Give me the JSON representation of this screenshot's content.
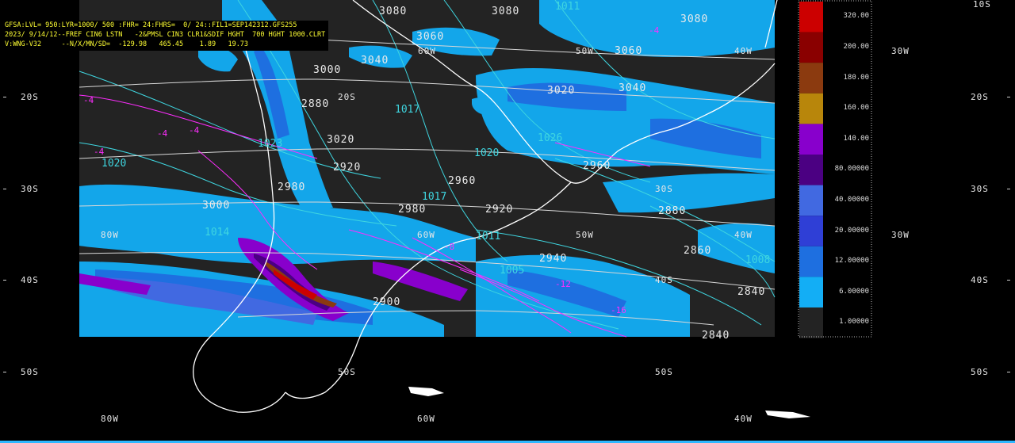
{
  "header": {
    "line1": "GFSA:LVL= 950:LYR=1000/ 500 :FHR= 24:FHRS=  0/ 24::FIL1=SEP142312.GFS255",
    "line2": "2023/ 9/14/12--FREF CIN6 LSTN   -2&PMSL CIN3 CLR1&SDIF HGHT  700 HGHT 1000.CLRT",
    "line3": "V:WNG-V32     --N/X/MN/SD=  -129.98   465.45    1.89   19.73"
  },
  "colorbar": {
    "levels": [
      {
        "label": "320.00",
        "color": "#cc0000"
      },
      {
        "label": "200.00",
        "color": "#8a0000"
      },
      {
        "label": "180.00",
        "color": "#8b3a0f"
      },
      {
        "label": "160.00",
        "color": "#b8860b"
      },
      {
        "label": "140.00",
        "color": "#8800cc"
      },
      {
        "label": "80.00000",
        "color": "#4b0082"
      },
      {
        "label": "40.00000",
        "color": "#4169e1"
      },
      {
        "label": "20.00000",
        "color": "#2f3fd6"
      },
      {
        "label": "12.00000",
        "color": "#1e6fe0"
      },
      {
        "label": "6.00000",
        "color": "#13aef5"
      },
      {
        "label": "1.00000",
        "color": "#232323"
      }
    ]
  },
  "grid_labels": {
    "lat_left": [
      "20S",
      "30S",
      "40S",
      "50S"
    ],
    "lat_right": [
      "10S",
      "20S",
      "30S",
      "40S",
      "50S"
    ],
    "lon_bottom": [
      "80W",
      "60W",
      "40W"
    ],
    "lon_right": "30W",
    "inner": [
      "80W",
      "60W",
      "50W",
      "40W",
      "30W",
      "20S",
      "30S",
      "40S",
      "50S",
      "80W",
      "60W",
      "40W"
    ]
  },
  "contour_labels": {
    "white": [
      "3080",
      "3080",
      "3060",
      "3040",
      "3020",
      "3040",
      "3000",
      "3000",
      "2980",
      "2960",
      "2960",
      "2940",
      "2920",
      "2900",
      "2880",
      "2860",
      "2840",
      "2840",
      "2880",
      "3080",
      "3060",
      "3020",
      "2980",
      "2920"
    ],
    "cyan": [
      "1020",
      "1017",
      "1020",
      "1017",
      "1014",
      "1011",
      "1008",
      "1005",
      "1011",
      "1023",
      "1026"
    ],
    "magenta": [
      "-4",
      "-4",
      "-4",
      "-4",
      "-4",
      "-8",
      "-12",
      "-16"
    ]
  }
}
